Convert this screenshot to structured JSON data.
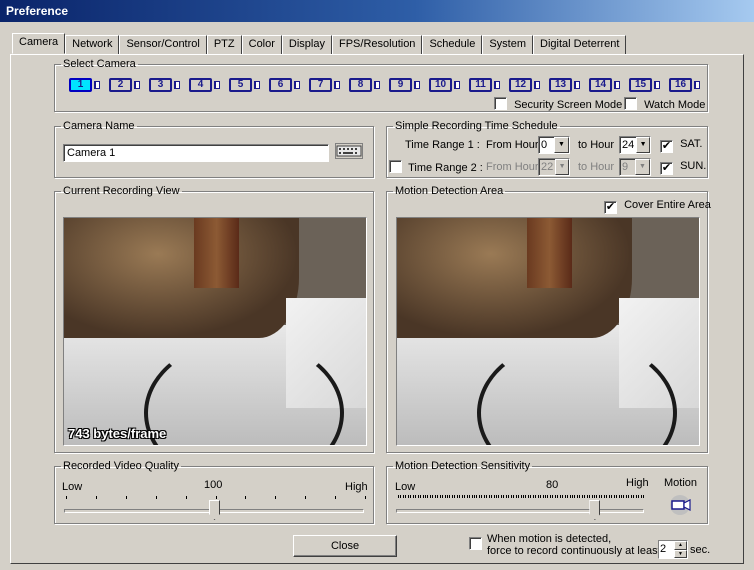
{
  "window": {
    "title": "Preference"
  },
  "tabs": [
    "Camera",
    "Network",
    "Sensor/Control",
    "PTZ",
    "Color",
    "Display",
    "FPS/Resolution",
    "Schedule",
    "System",
    "Digital Deterrent"
  ],
  "active_tab": 0,
  "select_camera": {
    "legend": "Select Camera",
    "cameras": [
      "1",
      "2",
      "3",
      "4",
      "5",
      "6",
      "7",
      "8",
      "9",
      "10",
      "11",
      "12",
      "13",
      "14",
      "15",
      "16"
    ],
    "selected": 0,
    "security_screen_mode": {
      "label": "Security Screen Mode",
      "checked": false
    },
    "watch_mode": {
      "label": "Watch Mode",
      "checked": false
    }
  },
  "camera_name": {
    "legend": "Camera Name",
    "value": "Camera 1"
  },
  "schedule": {
    "legend": "Simple Recording Time Schedule",
    "range1": {
      "label": "Time Range 1 :",
      "from_label": "From Hour",
      "from": "0",
      "to_label": "to Hour",
      "to": "24"
    },
    "range2": {
      "label": "Time Range 2 :",
      "checked": false,
      "from_label": "From Hour",
      "from": "22",
      "to_label": "to Hour",
      "to": "9"
    },
    "sat": {
      "label": "SAT.",
      "checked": true
    },
    "sun": {
      "label": "SUN.",
      "checked": true
    }
  },
  "recording_view": {
    "legend": "Current Recording View",
    "overlay": "743 bytes/frame"
  },
  "motion_area": {
    "legend": "Motion Detection Area",
    "cover_entire": {
      "label": "Cover Entire Area",
      "checked": true
    }
  },
  "quality": {
    "legend": "Recorded Video Quality",
    "low": "Low",
    "high": "High",
    "value_label": "100",
    "fraction": 0.5
  },
  "sensitivity": {
    "legend": "Motion Detection Sensitivity",
    "low": "Low",
    "high": "High",
    "value_label": "80",
    "fraction": 0.8,
    "motion_label": "Motion"
  },
  "close_label": "Close",
  "force_record": {
    "line1": "When motion is detected,",
    "line2": "force to record continuously at least",
    "checked": false,
    "value": "2",
    "unit": "sec."
  },
  "check_mark": "✔"
}
